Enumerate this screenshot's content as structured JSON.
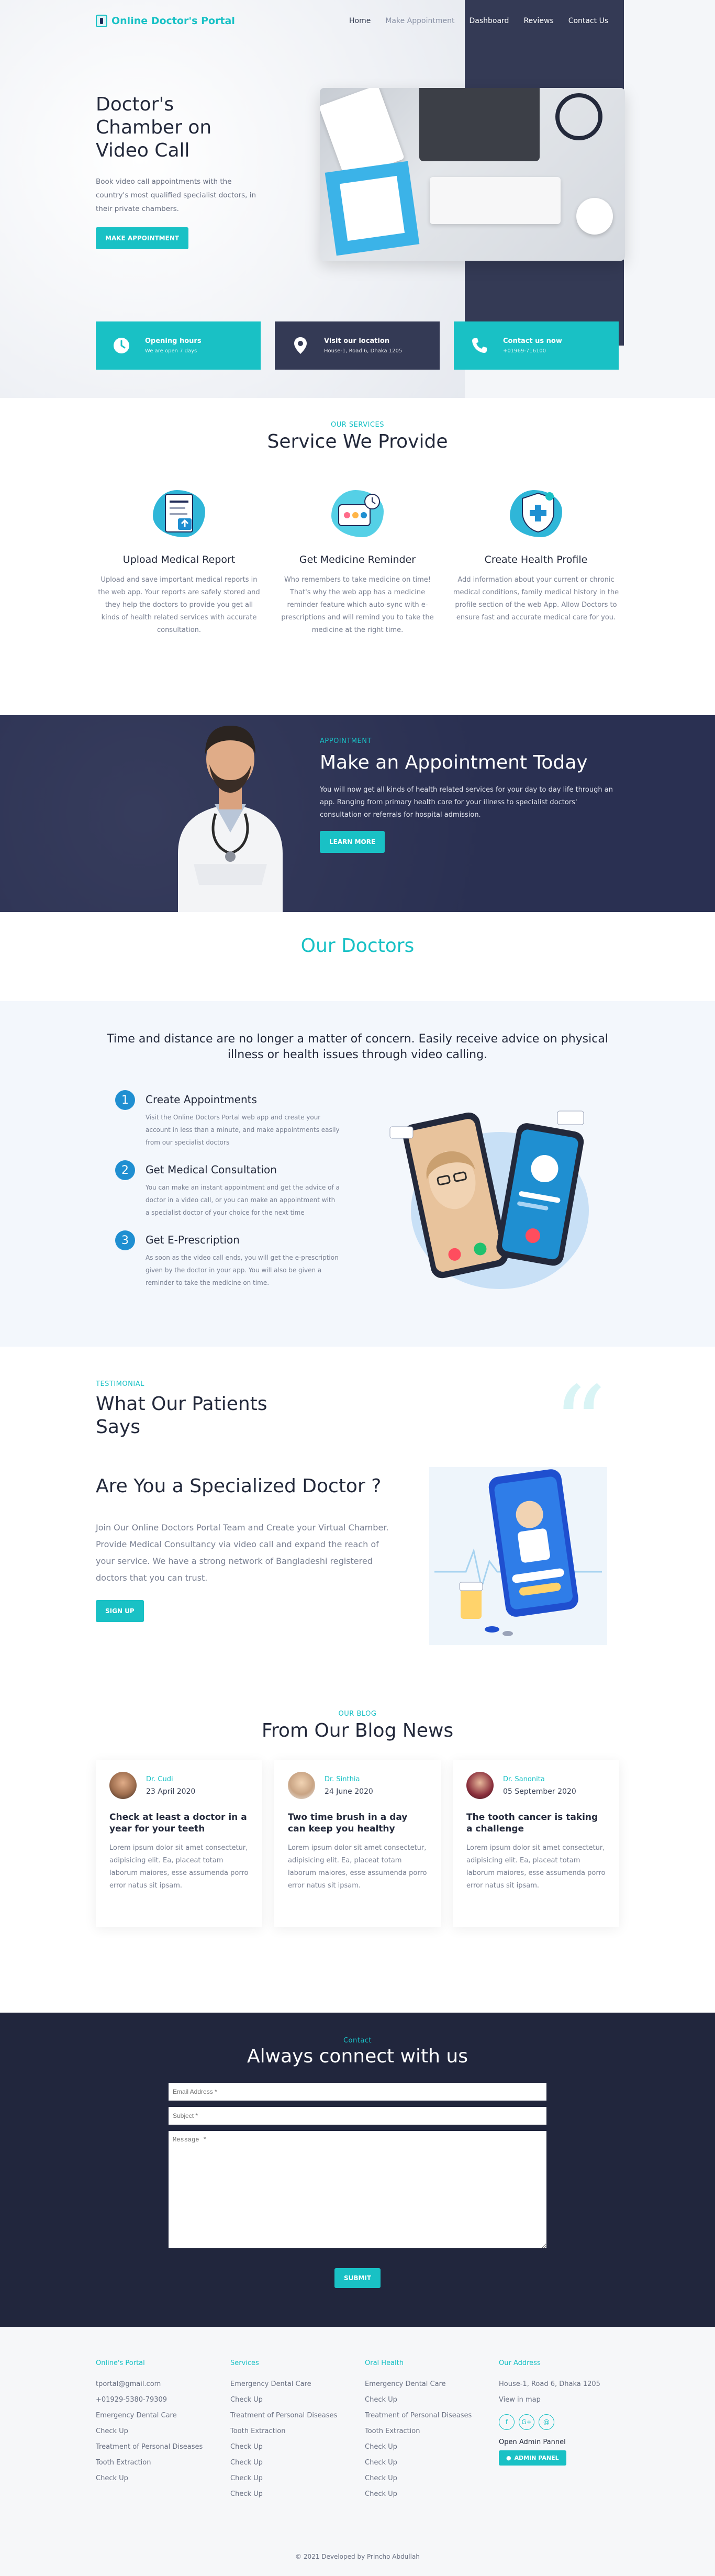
{
  "nav": {
    "brand": "Online Doctor's Portal",
    "links": [
      "Home",
      "Make Appointment",
      "Dashboard",
      "Reviews",
      "Contact Us"
    ]
  },
  "hero": {
    "title": "Doctor's Chamber on Video Call",
    "lead": "Book video call appointments with the country's most qualified specialist doctors, in their private chambers.",
    "cta": "MAKE APPOINTMENT"
  },
  "info_cards": [
    {
      "title": "Opening hours",
      "sub": "We are open 7 days",
      "icon": "clock-icon"
    },
    {
      "title": "Visit our location",
      "sub": "House-1, Road 6, Dhaka 1205",
      "icon": "location-pin-icon"
    },
    {
      "title": "Contact us now",
      "sub": "+01969-716100",
      "icon": "phone-icon"
    }
  ],
  "services": {
    "eyebrow": "OUR SERVICES",
    "title": "Service We Provide",
    "items": [
      {
        "title": "Upload Medical Report",
        "text": "Upload and save important medical reports in the web app. Your reports are safely stored and they help the doctors to provide you get all kinds of health related services with accurate consultation."
      },
      {
        "title": "Get Medicine Reminder",
        "text": "Who remembers to take medicine on time! That's why the web app has a medicine reminder feature which auto-sync with e-prescriptions and will remind you to take the medicine at the right time."
      },
      {
        "title": "Create Health Profile",
        "text": "Add information about your current or chronic medical conditions, family medical history in the profile section of the web App. Allow Doctors to ensure fast and accurate medical care for you."
      }
    ]
  },
  "appointment": {
    "eyebrow": "APPOINTMENT",
    "title": "Make an Appointment Today",
    "text": "You will now get all kinds of health related services for your day to day life through an app. Ranging from primary health care for your illness to specialist doctors' consultation or referrals for hospital admission.",
    "cta": "LEARN MORE"
  },
  "our_doctors": {
    "title": "Our Doctors"
  },
  "video": {
    "intro": "Time and distance are no longer a matter of concern. Easily receive advice on physical illness or health issues through video calling.",
    "steps": [
      {
        "n": "1",
        "title": "Create Appointments",
        "text": "Visit the Online Doctors Portal web app and create your account in less than a minute, and make appointments easily from our specialist doctors"
      },
      {
        "n": "2",
        "title": "Get Medical Consultation",
        "text": "You can make an instant appointment and get the advice of a doctor in a video call, or you can make an appointment with a specialist doctor of your choice for the next time"
      },
      {
        "n": "3",
        "title": "Get E-Prescription",
        "text": "As soon as the video call ends, you will get the e-prescription given by the doctor in your app. You will also be given a reminder to take the medicine on time."
      }
    ]
  },
  "testimonial": {
    "eyebrow": "TESTIMONIAL",
    "title": "What Our Patients Says"
  },
  "specialized": {
    "title": "Are You a Specialized Doctor ?",
    "text": "Join Our Online Doctors Portal Team and Create your Virtual Chamber. Provide Medical Consultancy via video call and expand the reach of your service. We have a strong network of Bangladeshi registered doctors that you can trust.",
    "cta": "SIGN UP"
  },
  "blog": {
    "eyebrow": "OUR BLOG",
    "title": "From Our Blog News",
    "posts": [
      {
        "author": "Dr. Cudi",
        "date": "23 April 2020",
        "title": "Check at least a doctor in a year for your teeth",
        "text": "Lorem ipsum dolor sit amet consectetur, adipisicing elit. Ea, placeat totam laborum maiores, esse assumenda porro error natus sit ipsam."
      },
      {
        "author": "Dr. Sinthia",
        "date": "24 June 2020",
        "title": "Two time brush in a day can keep you healthy",
        "text": "Lorem ipsum dolor sit amet consectetur, adipisicing elit. Ea, placeat totam laborum maiores, esse assumenda porro error natus sit ipsam."
      },
      {
        "author": "Dr. Sanonita",
        "date": "05 September 2020",
        "title": "The tooth cancer is taking a challenge",
        "text": "Lorem ipsum dolor sit amet consectetur, adipisicing elit. Ea, placeat totam laborum maiores, esse assumenda porro error natus sit ipsam."
      }
    ]
  },
  "contact": {
    "eyebrow": "Contact",
    "title": "Always connect with us",
    "email_placeholder": "Email Address *",
    "subject_placeholder": "Subject *",
    "message_placeholder": "Message *",
    "submit": "SUBMIT"
  },
  "footer": {
    "col1": {
      "title": "Online's Portal",
      "items": [
        "tportal@gmail.com",
        "+01929-5380-79309",
        "Emergency Dental Care",
        "Check Up",
        "Treatment of Personal Diseases",
        "Tooth Extraction",
        "Check Up"
      ]
    },
    "col2": {
      "title": "Services",
      "items": [
        "Emergency Dental Care",
        "Check Up",
        "Treatment of Personal Diseases",
        "Tooth Extraction",
        "Check Up",
        "Check Up",
        "Check Up",
        "Check Up"
      ]
    },
    "col3": {
      "title": "Oral Health",
      "items": [
        "Emergency Dental Care",
        "Check Up",
        "Treatment of Personal Diseases",
        "Tooth Extraction",
        "Check Up",
        "Check Up",
        "Check Up",
        "Check Up"
      ]
    },
    "col4": {
      "title": "Our Address",
      "items": [
        "House-1, Road 6, Dhaka 1205",
        "View in map"
      ],
      "socials": [
        "f",
        "G+",
        "@"
      ],
      "admin_label": "Open Admin Pannel",
      "admin_button": "ADMIN PANEL"
    },
    "copyright": "© 2021 Developed by Princho Abdullah"
  },
  "colors": {
    "accent": "#19c1c5",
    "navy": "#343a55",
    "dark": "#21263d",
    "blue": "#1f8fd1"
  }
}
